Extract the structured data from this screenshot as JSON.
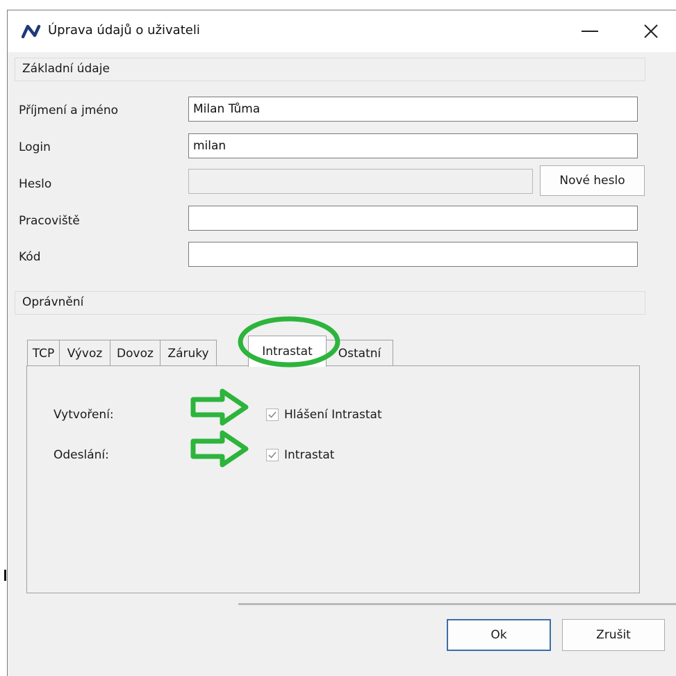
{
  "window": {
    "title": "Úprava údajů o uživateli",
    "app_icon": "nortis-logo-icon",
    "minimize_symbol": "—",
    "close_symbol": "✕"
  },
  "basic": {
    "header": "Základní údaje",
    "fields": [
      {
        "label": "Příjmení a jméno",
        "value": "Milan Tůma"
      },
      {
        "label": "Login",
        "value": "milan"
      },
      {
        "label": "Heslo",
        "value": ""
      },
      {
        "label": "Pracoviště",
        "value": ""
      },
      {
        "label": "Kód",
        "value": ""
      }
    ],
    "new_password_label": "Nové heslo"
  },
  "permissions": {
    "header": "Oprávnění",
    "tabs": [
      "TCP",
      "Vývoz",
      "Dovoz",
      "Záruky",
      "Intrastat",
      "Ostatní"
    ],
    "active_tab": "Intrastat",
    "rows": [
      {
        "label": "Vytvoření:",
        "checkbox_label": "Hlášení Intrastat",
        "checked": true
      },
      {
        "label": "Odeslání:",
        "checkbox_label": "Intrastat",
        "checked": true
      }
    ]
  },
  "footer": {
    "ok_label": "Ok",
    "cancel_label": "Zrušit"
  },
  "colors": {
    "annotation_green": "#2db43c",
    "logo_blue": "#1f3a78",
    "ok_border": "#3b6ea8"
  }
}
